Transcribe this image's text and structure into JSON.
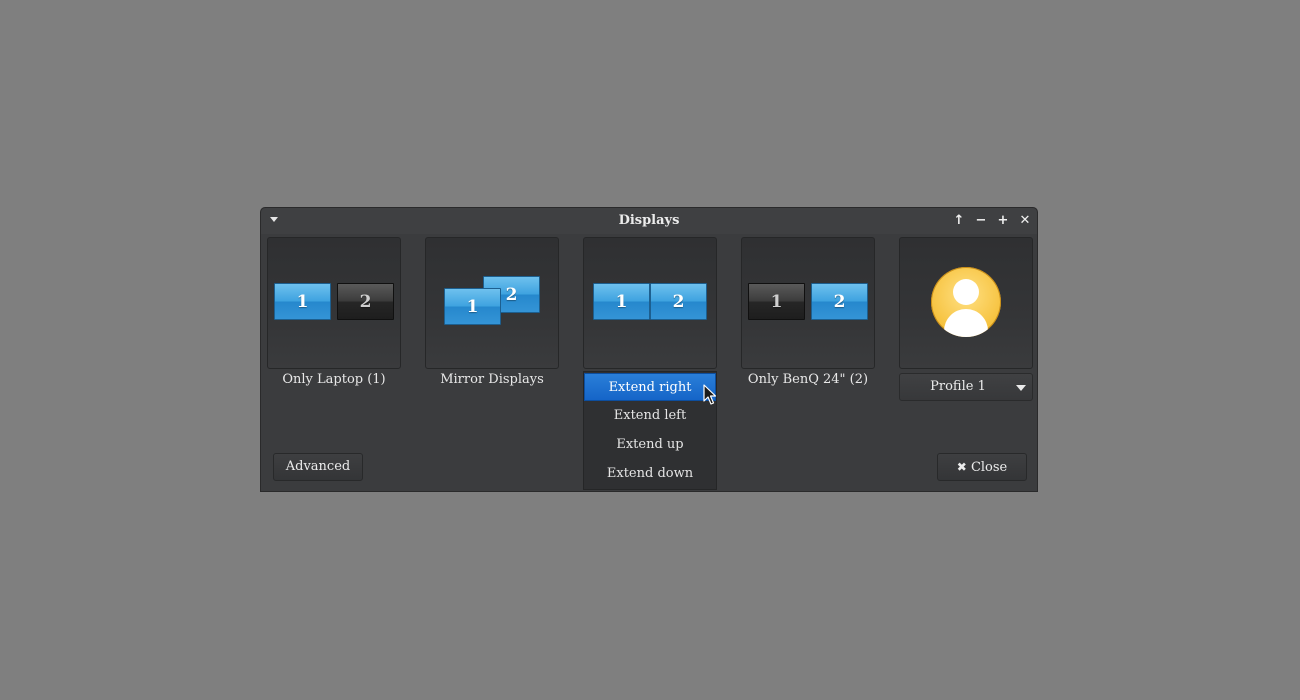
{
  "window": {
    "title": "Displays",
    "controls": {
      "keep_above": "↑",
      "minimize": "−",
      "maximize": "+",
      "close": "✕"
    }
  },
  "layouts": [
    {
      "label": "Only Laptop (1)",
      "monitors": [
        {
          "num": "1",
          "active": true
        },
        {
          "num": "2",
          "active": false
        }
      ]
    },
    {
      "label": "Mirror Displays",
      "monitors": [
        {
          "num": "2",
          "active": true
        },
        {
          "num": "1",
          "active": true
        }
      ]
    },
    {
      "label": "",
      "monitors": [
        {
          "num": "1",
          "active": true
        },
        {
          "num": "2",
          "active": true
        }
      ]
    },
    {
      "label": "Only BenQ 24\" (2)",
      "monitors": [
        {
          "num": "1",
          "active": false
        },
        {
          "num": "2",
          "active": true
        }
      ]
    }
  ],
  "extend_menu": {
    "items": [
      "Extend right",
      "Extend left",
      "Extend up",
      "Extend down"
    ],
    "selected": "Extend right"
  },
  "profile": {
    "avatar_icon": "user-avatar-icon",
    "selected": "Profile 1"
  },
  "buttons": {
    "advanced": "Advanced",
    "close_icon": "✖",
    "close": "Close"
  },
  "colors": {
    "accent": "#1565c8",
    "monitor_active": "#3fa3e0",
    "avatar": "#f6c23e"
  }
}
